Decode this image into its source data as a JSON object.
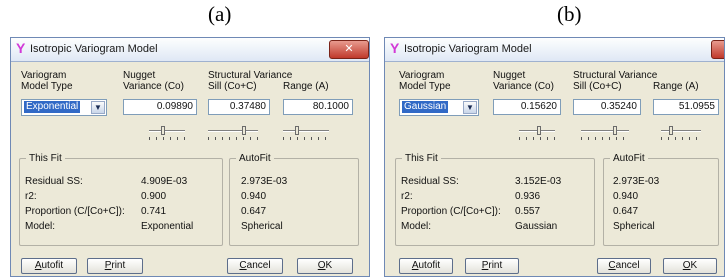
{
  "panels": [
    {
      "label": "(a)",
      "title": "Isotropic Variogram Model",
      "close_glyph": "✕",
      "app_icon": "variogram-y-icon",
      "headers": {
        "model_type": [
          "Variogram",
          "Model Type"
        ],
        "nugget": [
          "Nugget",
          "Variance (Co)"
        ],
        "structural": "Structural Variance",
        "sill": "Sill (Co+C)",
        "range": "Range (A)"
      },
      "model_type": "Exponential",
      "nugget": "0.09890",
      "sill": "0.37480",
      "range": "80.1000",
      "this_fit_title": "This Fit",
      "autofit_title": "AutoFit",
      "rows": [
        {
          "label": "Residual SS:",
          "this": "4.909E-03",
          "auto": "2.973E-03"
        },
        {
          "label": "r2:",
          "this": "0.900",
          "auto": "0.940"
        },
        {
          "label": "Proportion (C/[Co+C]):",
          "this": "0.741",
          "auto": "0.647"
        },
        {
          "label": "Model:",
          "this": "Exponential",
          "auto": "Spherical"
        }
      ],
      "buttons": {
        "autofit": {
          "mn": "A",
          "rest": "utofit"
        },
        "print": {
          "mn": "P",
          "rest": "rint"
        },
        "cancel": {
          "mn": "C",
          "rest": "ancel"
        },
        "ok": {
          "mn": "O",
          "rest": "K"
        }
      }
    },
    {
      "label": "(b)",
      "title": "Isotropic Variogram Model",
      "close_glyph": "✕",
      "app_icon": "variogram-y-icon",
      "headers": {
        "model_type": [
          "Variogram",
          "Model Type"
        ],
        "nugget": [
          "Nugget",
          "Variance (Co)"
        ],
        "structural": "Structural Variance",
        "sill": "Sill (Co+C)",
        "range": "Range (A)"
      },
      "model_type": "Gaussian",
      "nugget": "0.15620",
      "sill": "0.35240",
      "range": "51.0955",
      "this_fit_title": "This Fit",
      "autofit_title": "AutoFit",
      "rows": [
        {
          "label": "Residual SS:",
          "this": "3.152E-03",
          "auto": "2.973E-03"
        },
        {
          "label": "r2:",
          "this": "0.936",
          "auto": "0.940"
        },
        {
          "label": "Proportion (C/[Co+C]):",
          "this": "0.557",
          "auto": "0.647"
        },
        {
          "label": "Model:",
          "this": "Gaussian",
          "auto": "Spherical"
        }
      ],
      "buttons": {
        "autofit": {
          "mn": "A",
          "rest": "utofit"
        },
        "print": {
          "mn": "P",
          "rest": "rint"
        },
        "cancel": {
          "mn": "C",
          "rest": "ancel"
        },
        "ok": {
          "mn": "O",
          "rest": "K"
        }
      }
    }
  ],
  "colors": {
    "window_bg": "#ece9d8",
    "selection": "#3169c6",
    "close_button": "#c0392b",
    "app_icon": "#d23ad7"
  }
}
